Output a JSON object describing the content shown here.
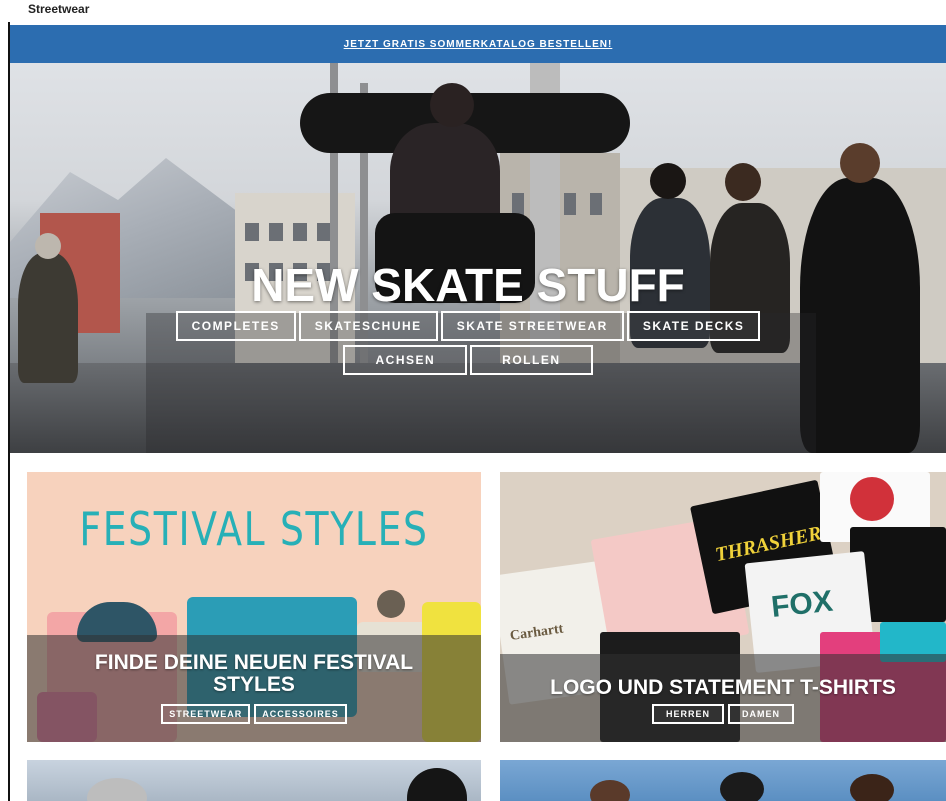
{
  "header": {
    "site_label": "Streetwear",
    "promo_text": "JETZT GRATIS SOMMERKATALOG BESTELLEN!"
  },
  "hero": {
    "title": "NEW SKATE STUFF",
    "buttons_row1": [
      "COMPLETES",
      "SKATESCHUHE",
      "SKATE STREETWEAR",
      "SKATE DECKS"
    ],
    "buttons_row2": [
      "ACHSEN",
      "ROLLEN"
    ]
  },
  "tiles": [
    {
      "heading": "FESTIVAL STYLES",
      "title": "FINDE DEINE NEUEN FESTIVAL STYLES",
      "buttons": [
        "STREETWEAR",
        "ACCESSOIRES"
      ]
    },
    {
      "title": "LOGO UND STATEMENT T-SHIRTS",
      "buttons": [
        "HERREN",
        "DAMEN"
      ],
      "brand_prints": [
        "Carhartt",
        "THRASHER",
        "FOX"
      ]
    }
  ],
  "colors": {
    "promo_bg": "#2c6db0",
    "festival_text": "#27b0b7"
  }
}
